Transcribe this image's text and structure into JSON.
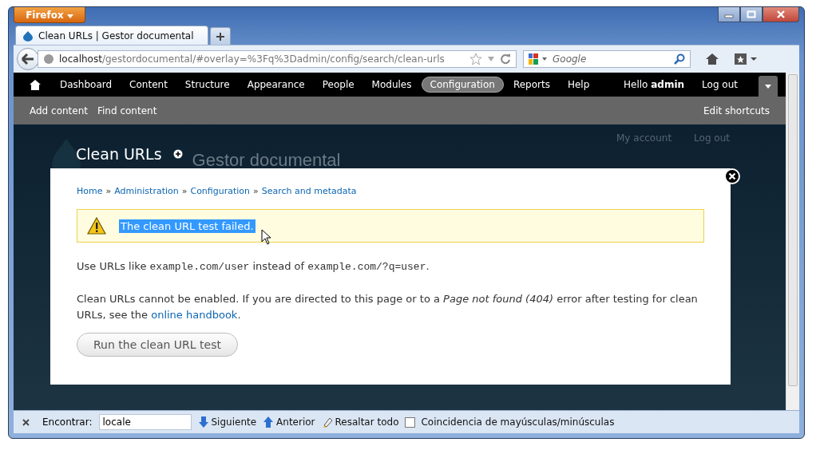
{
  "app_button": "Firefox",
  "tabs": [
    {
      "title": "Clean URLs | Gestor documental",
      "selected": true
    }
  ],
  "address": {
    "host": "localhost",
    "path": "/gestordocumental/#overlay=%3Fq%3Dadmin/config/search/clean-urls"
  },
  "search": {
    "placeholder": "Google"
  },
  "toolbar": {
    "items": [
      {
        "label": "Dashboard",
        "selected": false
      },
      {
        "label": "Content",
        "selected": false
      },
      {
        "label": "Structure",
        "selected": false
      },
      {
        "label": "Appearance",
        "selected": false
      },
      {
        "label": "People",
        "selected": false
      },
      {
        "label": "Modules",
        "selected": false
      },
      {
        "label": "Configuration",
        "selected": true
      },
      {
        "label": "Reports",
        "selected": false
      },
      {
        "label": "Help",
        "selected": false
      }
    ],
    "greeting": "Hello **admin**",
    "logout": "Log out"
  },
  "shortcuts": {
    "items": [
      "Add content",
      "Find content"
    ],
    "edit": "Edit shortcuts"
  },
  "site": {
    "name": "Gestor documental",
    "links": [
      "My account",
      "Log out"
    ]
  },
  "page_title": "Clean URLs",
  "overlay": {
    "breadcrumb": [
      "Home",
      "Administration",
      "Configuration",
      "Search and metadata"
    ],
    "breadcrumb_separator": "»",
    "message": {
      "kind": "warning",
      "text": "The clean URL test failed.",
      "highlighted": true
    },
    "paragraphs": [
      [
        {
          "kind": "text",
          "text": "Use URLs like "
        },
        {
          "kind": "code",
          "text": "example.com/user"
        },
        {
          "kind": "text",
          "text": " instead of "
        },
        {
          "kind": "code",
          "text": "example.com/?q=user"
        },
        {
          "kind": "text",
          "text": "."
        }
      ],
      [
        {
          "kind": "text",
          "text": "Clean URLs cannot be enabled. If you are directed to this page or to a *Page not found (404)* error after testing for clean URLs, see the "
        },
        {
          "kind": "link",
          "text": "online handbook"
        },
        {
          "kind": "text",
          "text": "."
        }
      ]
    ],
    "button": "Run the clean URL test"
  },
  "find_bar": {
    "label": "Encontrar:",
    "value": "locale",
    "next": "Siguiente",
    "previous": "Anterior",
    "highlight_all": "Resaltar todo",
    "match_case": {
      "label": "Coincidencia de mayúsculas/minúsculas",
      "checked": false
    }
  }
}
